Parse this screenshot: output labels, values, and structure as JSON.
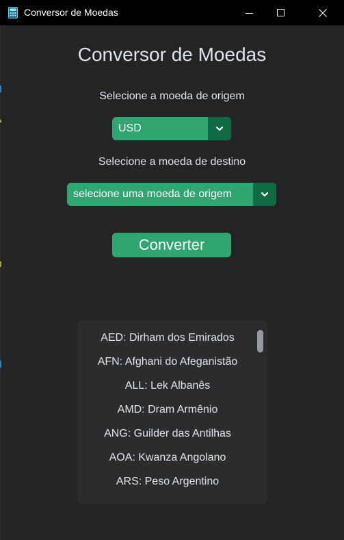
{
  "window": {
    "title": "Conversor de Moedas",
    "icon": "calculator-icon"
  },
  "app": {
    "title": "Conversor de Moedas",
    "origin_label": "Selecione a moeda de origem",
    "origin_value": "USD",
    "dest_label": "Selecione a moeda de destino",
    "dest_value": "selecione uma moeda de origem",
    "convert_label": "Converter"
  },
  "currency_list": [
    "AED: Dirham dos Emirados",
    "AFN: Afghani do Afeganistão",
    "ALL: Lek Albanês",
    "AMD: Dram Armênio",
    "ANG: Guilder das Antilhas",
    "AOA: Kwanza Angolano",
    "ARS: Peso Argentino"
  ],
  "colors": {
    "background": "#242424",
    "accent": "#2fa572",
    "accent_dark": "#106a43",
    "text": "#dce4ee",
    "panel": "#2c2c2c"
  }
}
